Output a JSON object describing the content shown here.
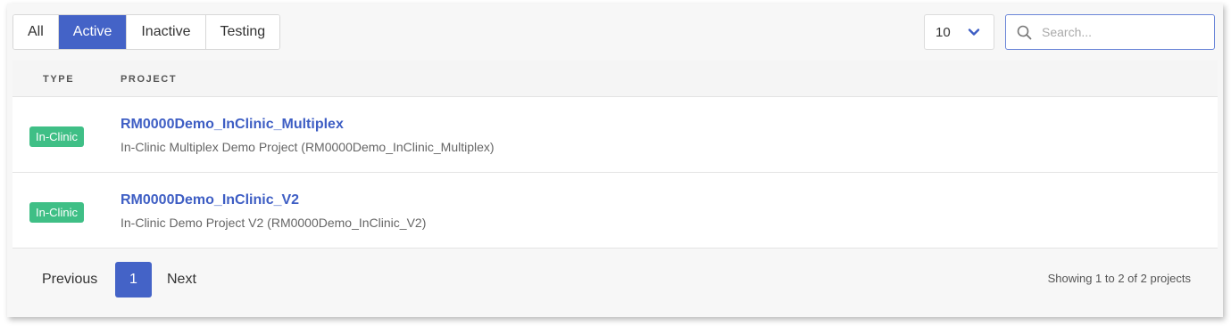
{
  "filters": {
    "all": "All",
    "active": "Active",
    "inactive": "Inactive",
    "testing": "Testing",
    "selected": "Active"
  },
  "page_size": {
    "value": "10",
    "icon": "chevron-down-icon"
  },
  "search": {
    "placeholder": "Search...",
    "value": "",
    "icon": "search-icon"
  },
  "table": {
    "headers": {
      "type": "TYPE",
      "project": "PROJECT"
    },
    "rows": [
      {
        "type": "In-Clinic",
        "title": "RM0000Demo_InClinic_Multiplex",
        "description": "In-Clinic Multiplex Demo Project (RM0000Demo_InClinic_Multiplex)"
      },
      {
        "type": "In-Clinic",
        "title": "RM0000Demo_InClinic_V2",
        "description": "In-Clinic Demo Project V2 (RM0000Demo_InClinic_V2)"
      }
    ]
  },
  "pagination": {
    "previous": "Previous",
    "current": "1",
    "next": "Next",
    "showing": "Showing 1 to 2 of 2 projects"
  },
  "colors": {
    "accent": "#4463c7",
    "badge": "#3fbf86",
    "link": "#3e5ec4"
  }
}
